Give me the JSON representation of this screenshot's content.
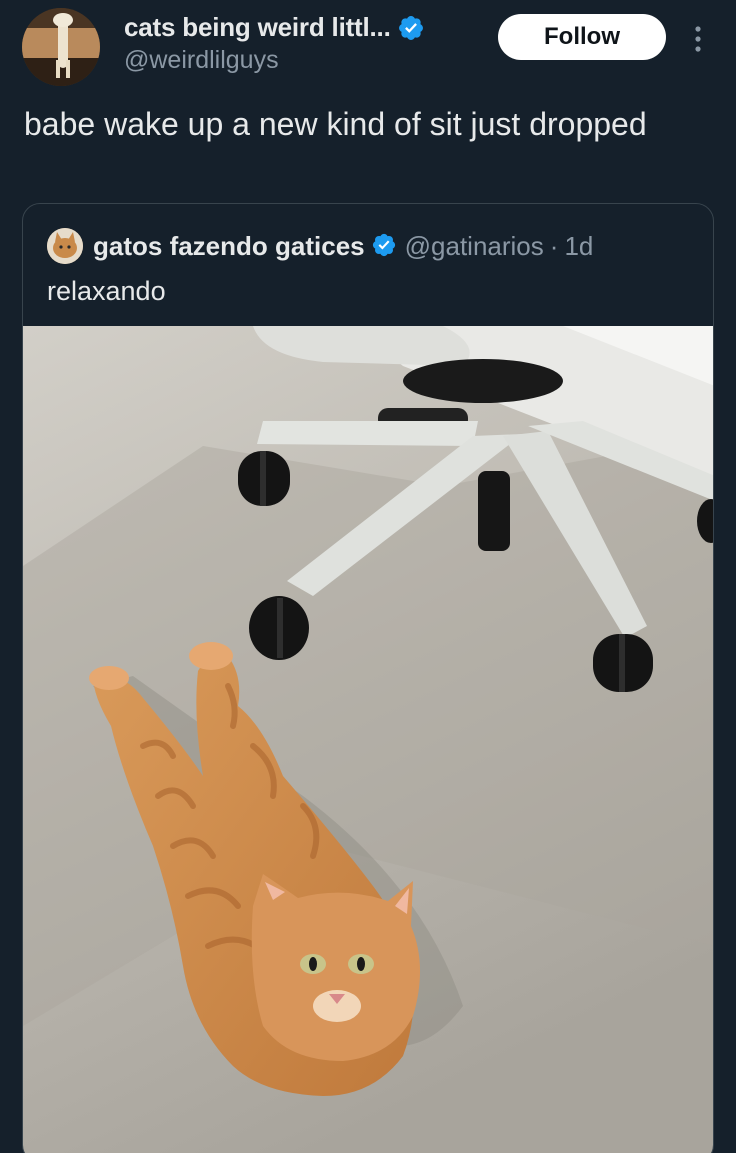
{
  "author": {
    "display_name": "cats being weird littl...",
    "handle": "@weirdlilguys",
    "verified_icon": "verified-badge-icon",
    "avatar_icon": "cat-avatar"
  },
  "follow_label": "Follow",
  "more_icon": "vertical-ellipsis-icon",
  "tweet_text": "babe wake up a new kind of sit just dropped",
  "quote": {
    "display_name": "gatos fazendo gatices",
    "handle": "@gatinarios",
    "separator": "·",
    "time": "1d",
    "text": "relaxando",
    "verified_icon": "verified-badge-icon",
    "avatar_icon": "cat-avatar"
  },
  "colors": {
    "background": "#15202b",
    "text": "#e7e9ea",
    "muted": "#8b98a5",
    "verified": "#1d9bf0",
    "border": "#38444d"
  }
}
